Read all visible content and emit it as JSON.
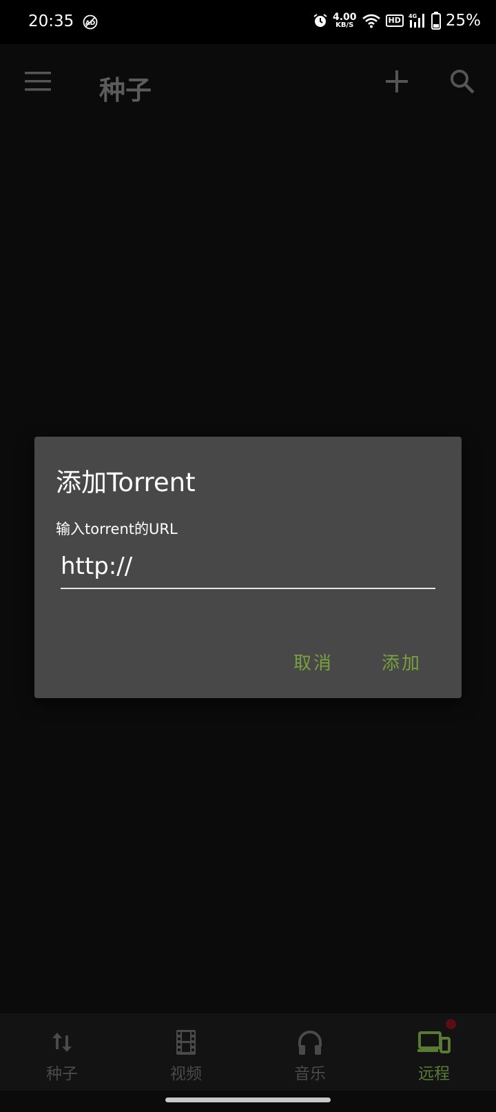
{
  "status_bar": {
    "time": "20:35",
    "speed_value": "4.00",
    "speed_unit": "KB/S",
    "hd_label": "HD",
    "network": "4G",
    "battery_percent": "25%"
  },
  "toolbar": {
    "title": "种子"
  },
  "dialog": {
    "title": "添加Torrent",
    "label": "输入torrent的URL",
    "input_value": "http://",
    "cancel_label": "取消",
    "add_label": "添加"
  },
  "bottom_nav": {
    "items": [
      {
        "label": "种子",
        "icon": "transfer-arrows-icon",
        "active": false
      },
      {
        "label": "视频",
        "icon": "film-icon",
        "active": false
      },
      {
        "label": "音乐",
        "icon": "headphones-icon",
        "active": false
      },
      {
        "label": "远程",
        "icon": "devices-icon",
        "active": true
      }
    ]
  },
  "colors": {
    "accent": "#7aa03e",
    "dialog_bg": "#484848",
    "background": "#0b0b0b",
    "badge": "#5a0d13"
  }
}
